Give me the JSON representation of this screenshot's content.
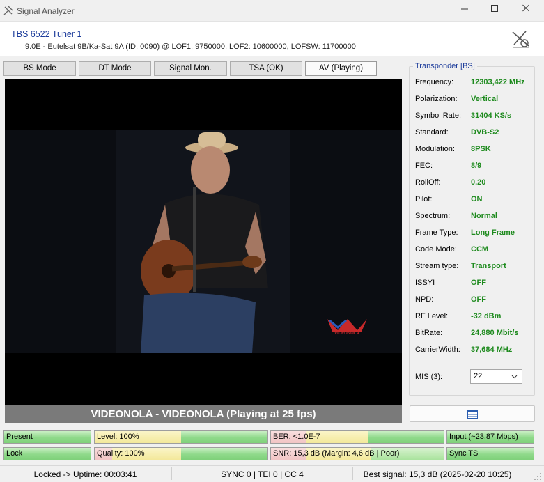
{
  "window": {
    "title": "Signal Analyzer"
  },
  "header": {
    "tuner": "TBS 6522 Tuner 1",
    "info": "9.0E - Eutelsat 9B/Ka-Sat 9A (ID: 0090) @ LOF1: 9750000, LOF2: 10600000, LOFSW: 11700000"
  },
  "tabs": [
    {
      "label": "BS Mode"
    },
    {
      "label": "DT Mode"
    },
    {
      "label": "Signal Mon."
    },
    {
      "label": "TSA (OK)"
    },
    {
      "label": "AV (Playing)",
      "active": true
    }
  ],
  "video": {
    "caption": "VIDEONOLA - VIDEONOLA (Playing at 25 fps)",
    "watermark": "VIDEONOLA"
  },
  "transponder": {
    "title": "Transponder [BS]",
    "rows": [
      {
        "label": "Frequency:",
        "value": "12303,422 MHz"
      },
      {
        "label": "Polarization:",
        "value": "Vertical"
      },
      {
        "label": "Symbol Rate:",
        "value": "31404 KS/s"
      },
      {
        "label": "Standard:",
        "value": "DVB-S2"
      },
      {
        "label": "Modulation:",
        "value": "8PSK"
      },
      {
        "label": "FEC:",
        "value": "8/9"
      },
      {
        "label": "RollOff:",
        "value": "0.20"
      },
      {
        "label": "Pilot:",
        "value": "ON"
      },
      {
        "label": "Spectrum:",
        "value": "Normal"
      },
      {
        "label": "Frame Type:",
        "value": "Long Frame"
      },
      {
        "label": "Code Mode:",
        "value": "CCM"
      },
      {
        "label": "Stream type:",
        "value": "Transport"
      },
      {
        "label": "ISSYI",
        "value": "OFF"
      },
      {
        "label": "NPD:",
        "value": "OFF"
      },
      {
        "label": "RF Level:",
        "value": "-32 dBm"
      },
      {
        "label": "BitRate:",
        "value": "24,880 Mbit/s"
      },
      {
        "label": "CarrierWidth:",
        "value": "37,684 MHz"
      }
    ],
    "mis_label": "MIS (3):",
    "mis_value": "22"
  },
  "indicators": {
    "present": "Present",
    "lock": "Lock",
    "level": "Level: 100%",
    "quality": "Quality: 100%",
    "ber": "BER: <1.0E-7",
    "snr": "SNR: 15,3 dB (Margin: 4,6 dB | Poor)",
    "input": "Input (~23,87 Mbps)",
    "sync": "Sync TS"
  },
  "status": {
    "uptime": "Locked -> Uptime: 00:03:41",
    "sync": "SYNC 0 | TEI 0 | CC 4",
    "best": "Best signal: 15,3 dB (2025-02-20 10:25)"
  },
  "colors": {
    "accent": "#1a3a9a",
    "value_green": "#1d8a1d"
  }
}
